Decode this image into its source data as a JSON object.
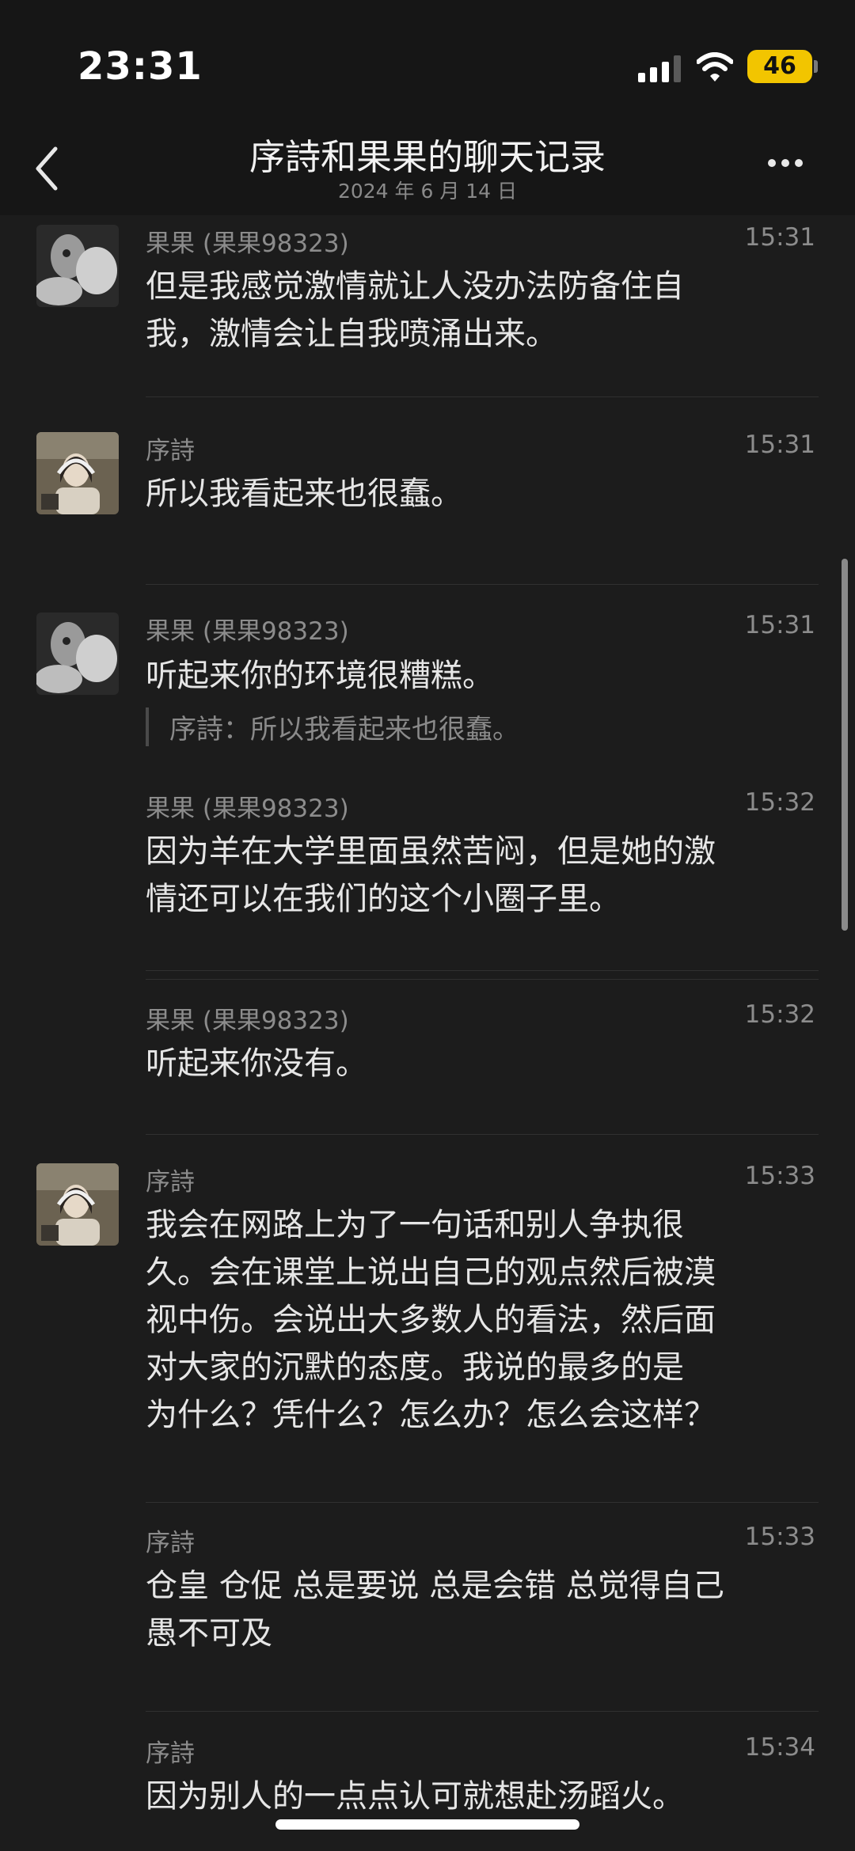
{
  "status_bar": {
    "time": "23:31",
    "battery": "46"
  },
  "header": {
    "title": "序詩和果果的聊天记录",
    "date": "2024 年 6 月 14 日"
  },
  "messages": [
    {
      "sender": "果果 (果果98323)",
      "time": "15:31",
      "avatar": "dark-portrait",
      "lines": [
        "但是我感觉激情就让人没办法防备住自",
        "我，激情会让自我喷涌出来。"
      ]
    },
    {
      "sender": "序詩",
      "time": "15:31",
      "avatar": "girl-headphones",
      "lines": [
        "所以我看起来也很蠢。"
      ]
    },
    {
      "sender": "果果 (果果98323)",
      "time": "15:31",
      "avatar": "dark-portrait",
      "lines": [
        "听起来你的环境很糟糕。"
      ],
      "quote": "序詩：所以我看起来也很蠢。"
    },
    {
      "sender": "果果 (果果98323)",
      "time": "15:32",
      "lines": [
        "因为羊在大学里面虽然苦闷，但是她的激",
        "情还可以在我们的这个小圈子里。"
      ]
    },
    {
      "sender": "果果 (果果98323)",
      "time": "15:32",
      "lines": [
        "听起来你没有。"
      ]
    },
    {
      "sender": "序詩",
      "time": "15:33",
      "avatar": "girl-headphones",
      "lines": [
        "我会在网路上为了一句话和别人争执很",
        "久。会在课堂上说出自己的观点然后被漠",
        "视中伤。会说出大多数人的看法，然后面",
        "对大家的沉默的态度。我说的最多的是",
        "为什么？凭什么？怎么办？怎么会这样？"
      ]
    },
    {
      "sender": "序詩",
      "time": "15:33",
      "lines": [
        "仓皇 仓促 总是要说 总是会错 总觉得自己",
        "愚不可及"
      ]
    },
    {
      "sender": "序詩",
      "time": "15:34",
      "lines": [
        "因为别人的一点点认可就想赴汤蹈火。"
      ]
    }
  ]
}
